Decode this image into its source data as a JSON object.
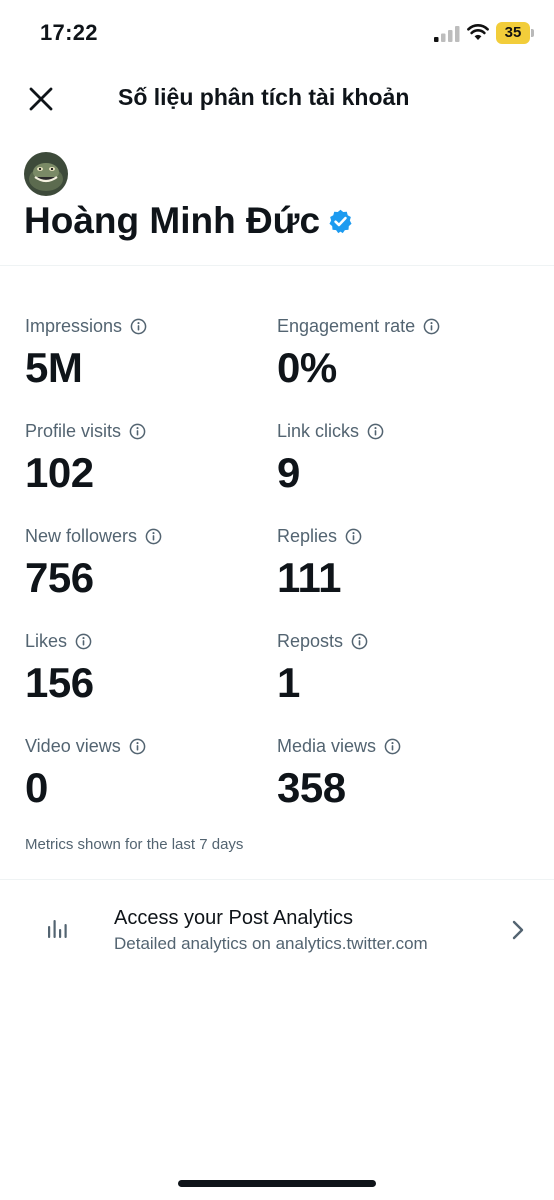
{
  "status_bar": {
    "time": "17:22",
    "battery_level": "35",
    "battery_color": "#f2cd3a"
  },
  "header": {
    "title": "Số liệu phân tích tài khoản",
    "close_icon": "close-icon"
  },
  "profile": {
    "name": "Hoàng Minh Đức",
    "verified": true,
    "verified_color": "#1d9bf0"
  },
  "metrics": [
    {
      "label": "Impressions",
      "value": "5M"
    },
    {
      "label": "Engagement rate",
      "value": "0%"
    },
    {
      "label": "Profile visits",
      "value": "102"
    },
    {
      "label": "Link clicks",
      "value": "9"
    },
    {
      "label": "New followers",
      "value": "756"
    },
    {
      "label": "Replies",
      "value": "111"
    },
    {
      "label": "Likes",
      "value": "156"
    },
    {
      "label": "Reposts",
      "value": "1"
    },
    {
      "label": "Video views",
      "value": "0"
    },
    {
      "label": "Media views",
      "value": "358"
    }
  ],
  "footnote": "Metrics shown for the last 7 days",
  "post_analytics": {
    "title": "Access your Post Analytics",
    "subtitle": "Detailed analytics on analytics.twitter.com",
    "icon": "bar-chart-icon",
    "chevron": "chevron-right-icon"
  },
  "colors": {
    "primary_text": "#0f1419",
    "secondary_text": "#536471",
    "divider": "#eff3f4"
  }
}
